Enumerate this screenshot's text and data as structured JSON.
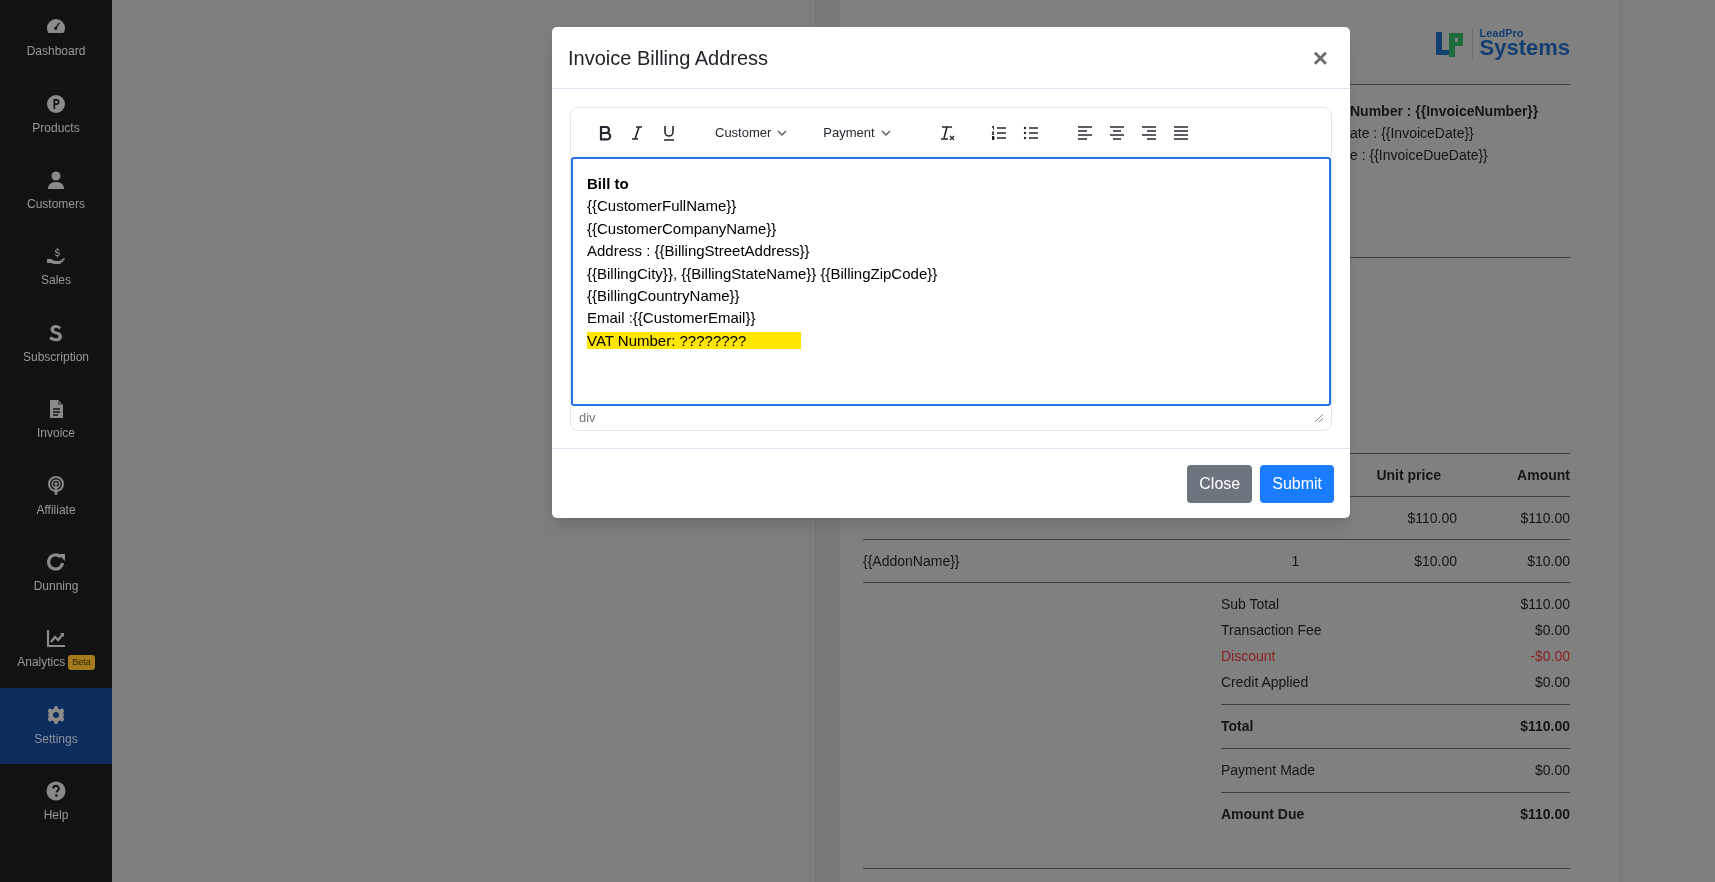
{
  "sidebar": {
    "items": [
      {
        "label": "Dashboard",
        "selected": false
      },
      {
        "label": "Products",
        "selected": false
      },
      {
        "label": "Customers",
        "selected": false
      },
      {
        "label": "Sales",
        "selected": false
      },
      {
        "label": "Subscription",
        "selected": false
      },
      {
        "label": "Invoice",
        "selected": false
      },
      {
        "label": "Affiliate",
        "selected": false
      },
      {
        "label": "Dunning",
        "selected": false
      },
      {
        "label": "Analytics",
        "selected": false,
        "badge": "Beta"
      },
      {
        "label": "Settings",
        "selected": true
      },
      {
        "label": "Help",
        "selected": false
      }
    ]
  },
  "invoice": {
    "logo": {
      "top": "LeadPro",
      "bottom": "Systems"
    },
    "meta": [
      {
        "text": "Number : {{InvoiceNumber}}",
        "bold": true
      },
      {
        "text": "ate : {{InvoiceDate}}",
        "bold": false
      },
      {
        "text": "e : {{InvoiceDueDate}}",
        "bold": false
      }
    ],
    "table": {
      "columns": [
        "Unit price",
        "Amount"
      ],
      "rows": [
        {
          "unit_price": "$110.00",
          "amount": "$110.00"
        },
        {
          "item": "{{AddonName}}",
          "qty": "1",
          "unit_price": "$10.00",
          "amount": "$10.00"
        }
      ]
    },
    "totals": [
      {
        "rows": [
          {
            "label": "Sub Total",
            "value": "$110.00",
            "kind": "normal"
          },
          {
            "label": "Transaction Fee",
            "value": "$0.00",
            "kind": "normal"
          },
          {
            "label": "Discount",
            "value": "-$0.00",
            "kind": "discount"
          },
          {
            "label": "Credit Applied",
            "value": "$0.00",
            "kind": "normal"
          }
        ]
      },
      {
        "rows": [
          {
            "label": "Total",
            "value": "$110.00",
            "kind": "strong"
          }
        ]
      },
      {
        "rows": [
          {
            "label": "Payment Made",
            "value": "$0.00",
            "kind": "normal"
          }
        ]
      },
      {
        "rows": [
          {
            "label": "Amount Due",
            "value": "$110.00",
            "kind": "strong"
          }
        ]
      }
    ]
  },
  "modal": {
    "title": "Invoice Billing Address",
    "close_symbol": "×",
    "toolbar": {
      "dropdowns": [
        "Customer",
        "Payment"
      ]
    },
    "editor": {
      "lines": [
        {
          "text": "Bill to",
          "bold": true,
          "highlighted": false
        },
        {
          "text": "{{CustomerFullName}}",
          "bold": false,
          "highlighted": false
        },
        {
          "text": "{{CustomerCompanyName}}",
          "bold": false,
          "highlighted": false
        },
        {
          "text": "Address : {{BillingStreetAddress}}",
          "bold": false,
          "highlighted": false
        },
        {
          "text": "{{BillingCity}}, {{BillingStateName}} {{BillingZipCode}}",
          "bold": false,
          "highlighted": false
        },
        {
          "text": "{{BillingCountryName}}",
          "bold": false,
          "highlighted": false
        },
        {
          "text": "Email :{{CustomerEmail}}",
          "bold": false,
          "highlighted": false
        },
        {
          "text": "VAT Number: ????????",
          "bold": false,
          "highlighted": true
        }
      ],
      "status": "div"
    },
    "buttons": [
      {
        "label": "Close",
        "kind": "secondary"
      },
      {
        "label": "Submit",
        "kind": "primary"
      }
    ]
  }
}
